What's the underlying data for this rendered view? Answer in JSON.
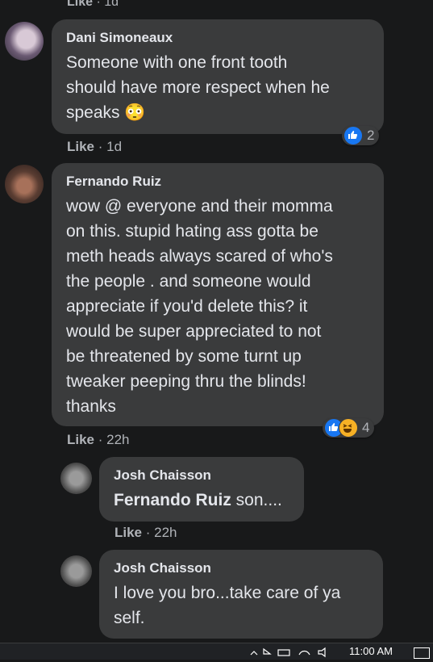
{
  "top": {
    "like": "Like",
    "time": "1d"
  },
  "comments": [
    {
      "author": "Dani Simoneaux",
      "text": "Someone with one front tooth\nshould have more respect when he\nspeaks 😳",
      "like": "Like",
      "time": "1d",
      "reaction_count": "2"
    },
    {
      "author": "Fernando Ruiz",
      "text": "wow @ everyone and their momma\non this. stupid hating ass gotta be\nmeth heads always scared of who's\nthe people . and someone would\nappreciate if you'd delete this? it\nwould be super appreciated to not\nbe threatened by some turnt up\ntweaker peeping thru the blinds!\nthanks",
      "like": "Like",
      "time": "22h",
      "reaction_count": "4"
    },
    {
      "author": "Josh Chaisson",
      "mention": "Fernando Ruiz",
      "text": " son....",
      "like": "Like",
      "time": "22h"
    },
    {
      "author": "Josh Chaisson",
      "text": "I love you bro...take care of ya\nself."
    }
  ],
  "taskbar": {
    "clock": "11:00 AM"
  },
  "colors": {
    "bubble": "#3a3b3c",
    "background": "#18191a",
    "like_blue": "#1877f2"
  },
  "icons": [
    "like-reaction-icon",
    "haha-reaction-icon",
    "notification-icon"
  ]
}
